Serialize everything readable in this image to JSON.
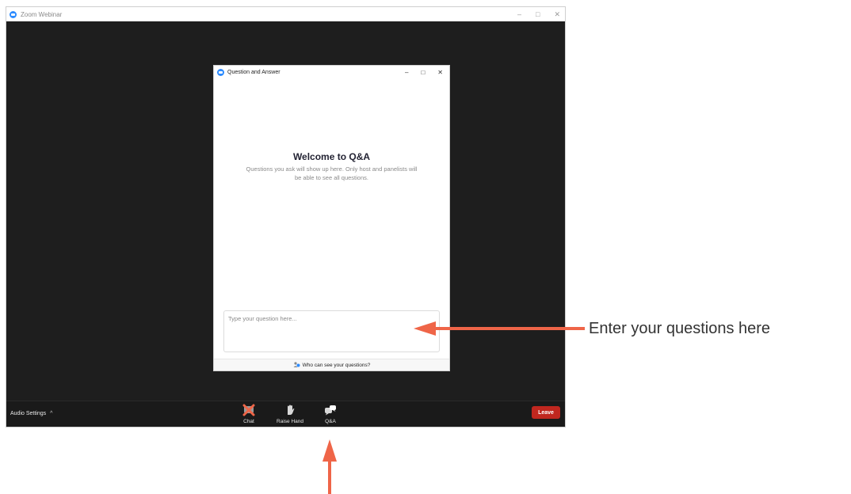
{
  "zoom_window": {
    "title": "Zoom Webinar",
    "controls": {
      "minimize": "–",
      "maximize": "□",
      "close": "✕"
    }
  },
  "toolbar": {
    "audio_settings": "Audio Settings",
    "audio_caret": "^",
    "chat_label": "Chat",
    "raise_hand_label": "Raise Hand",
    "qa_label": "Q&A",
    "leave_label": "Leave"
  },
  "qa_dialog": {
    "title": "Question and Answer",
    "controls": {
      "minimize": "–",
      "maximize": "□",
      "close": "✕"
    },
    "welcome_heading": "Welcome to Q&A",
    "description": "Questions you ask will show up here. Only host and panelists will be able to see all questions.",
    "input_placeholder": "Type your question here...",
    "footer_link": "Who can see your questions?"
  },
  "annotation": {
    "text": "Enter your questions here",
    "arrow_color": "#ef6548"
  },
  "colors": {
    "zoom_blue": "#2d8cff",
    "leave_red": "#c0271f",
    "chat_disabled_red": "#ef6548"
  }
}
